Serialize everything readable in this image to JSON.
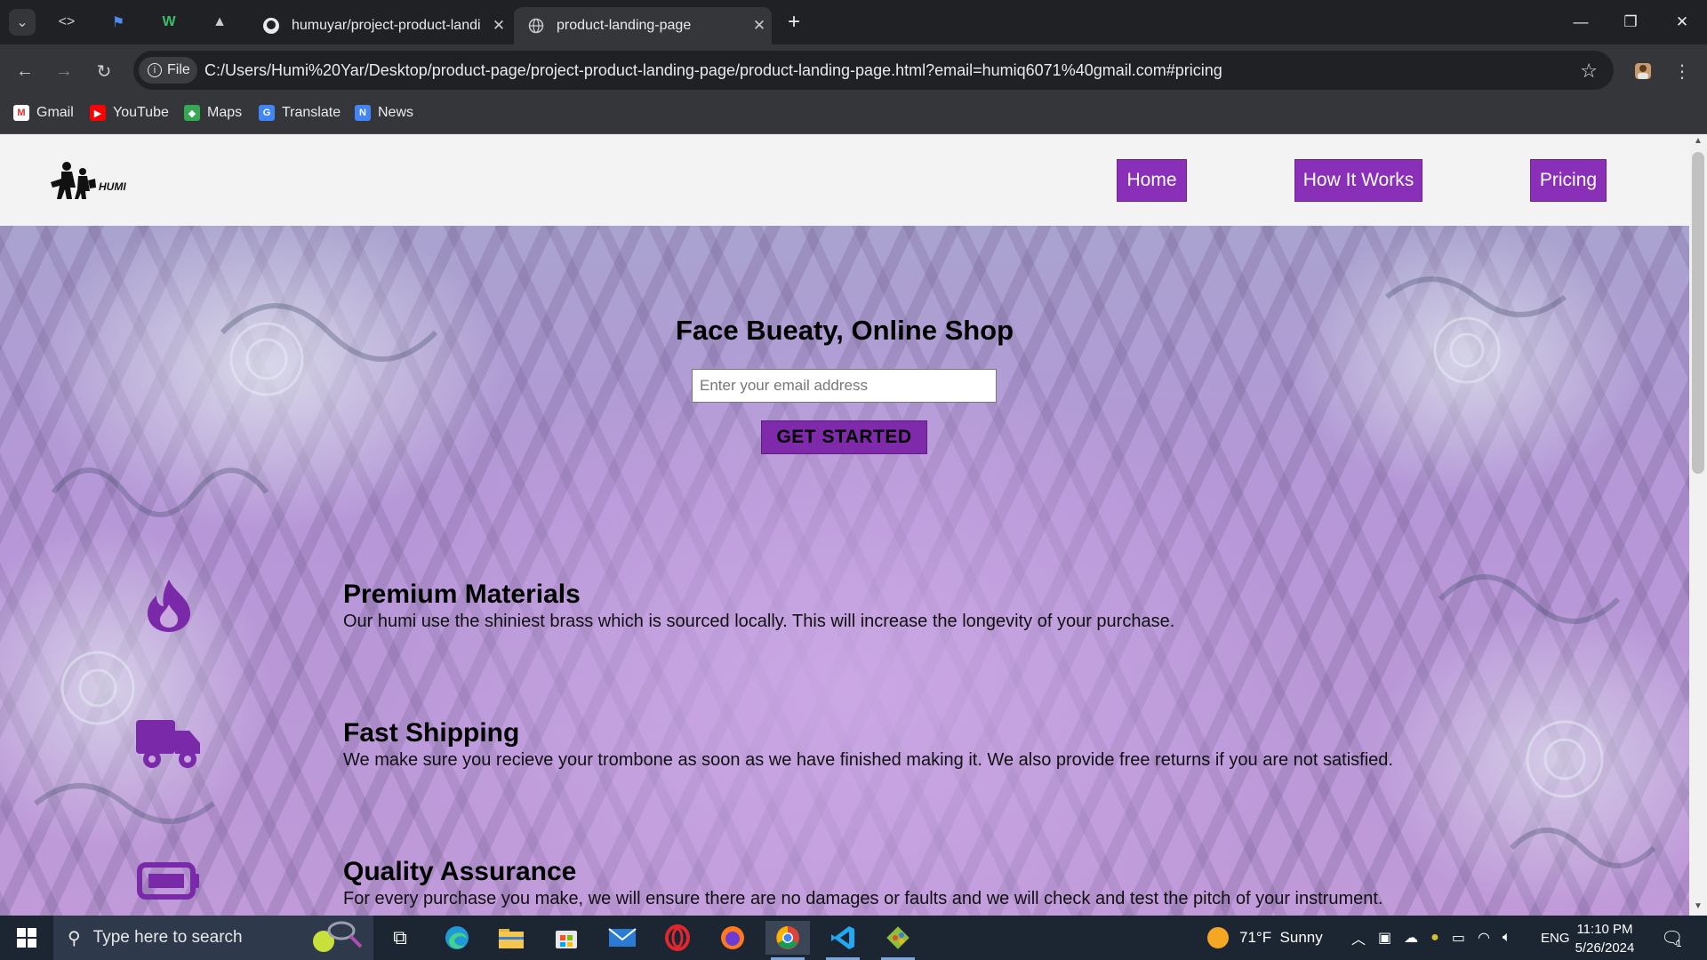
{
  "browser": {
    "tabs": [
      {
        "title": "humuyar/project-product-landi",
        "active": false
      },
      {
        "title": "product-landing-page",
        "active": true
      }
    ],
    "new_tab": "+",
    "address_chip": "File",
    "url": "C:/Users/Humi%20Yar/Desktop/product-page/project-product-landing-page/product-landing-page.html?email=humiq6071%40gmail.com#pricing",
    "bookmarks": [
      "Gmail",
      "YouTube",
      "Maps",
      "Translate",
      "News"
    ]
  },
  "site": {
    "logo_text": "HUMI",
    "nav": {
      "home": "Home",
      "how": "How It Works",
      "pricing": "Pricing"
    },
    "hero": {
      "title": "Face Bueaty, Online Shop",
      "email_placeholder": "Enter your email address",
      "cta": "GET STARTED"
    },
    "features": [
      {
        "icon": "fire-icon",
        "title": "Premium Materials",
        "desc": "Our humi use the shiniest brass which is sourced locally. This will increase the longevity of your purchase."
      },
      {
        "icon": "truck-icon",
        "title": "Fast Shipping",
        "desc": "We make sure you recieve your trombone as soon as we have finished making it. We also provide free returns if you are not satisfied."
      },
      {
        "icon": "battery-icon",
        "title": "Quality Assurance",
        "desc": "For every purchase you make, we will ensure there are no damages or faults and we will check and test the pitch of your instrument."
      }
    ],
    "accent_color": "#8a2fb8"
  },
  "taskbar": {
    "search_placeholder": "Type here to search",
    "weather": "71°F  Sunny",
    "language": "ENG",
    "time": "11:10 PM",
    "date": "5/26/2024",
    "notification_count": "1"
  }
}
